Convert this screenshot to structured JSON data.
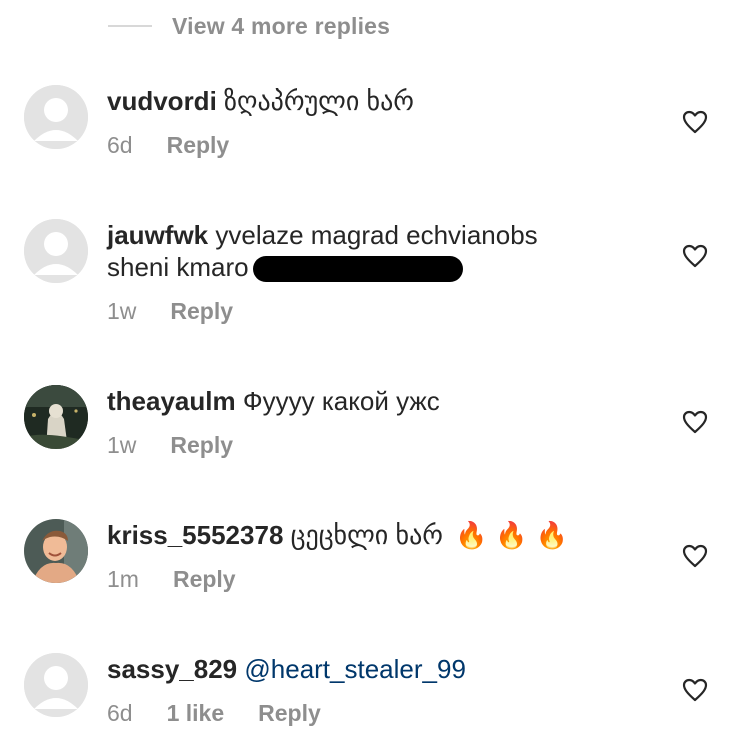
{
  "thread": {
    "view_more_label": "View 4 more replies"
  },
  "comments": [
    {
      "username": "vudvordi",
      "text": "ზღაპრული ხარ",
      "time": "6d",
      "reply_label": "Reply"
    },
    {
      "username": "jauwfwk",
      "text": "yvelaze magrad echvianobs sheni kmaro",
      "time": "1w",
      "reply_label": "Reply"
    },
    {
      "username": "theayaulm",
      "text": "Фуууу какой ужс",
      "time": "1w",
      "reply_label": "Reply"
    },
    {
      "username": "kriss_5552378",
      "text": "ცეცხლი ხარ",
      "emoji": "🔥🔥🔥",
      "time": "1m",
      "reply_label": "Reply"
    },
    {
      "username": "sassy_829",
      "mention": "@heart_stealer_99",
      "time": "6d",
      "likes": "1 like",
      "reply_label": "Reply"
    }
  ],
  "icons": {
    "like": "heart-outline-icon",
    "default_avatar": "default-avatar-icon"
  },
  "colors": {
    "text": "#262626",
    "secondary": "#8e8e8e",
    "mention": "#00376b",
    "avatar_placeholder": "#e3e3e3"
  }
}
